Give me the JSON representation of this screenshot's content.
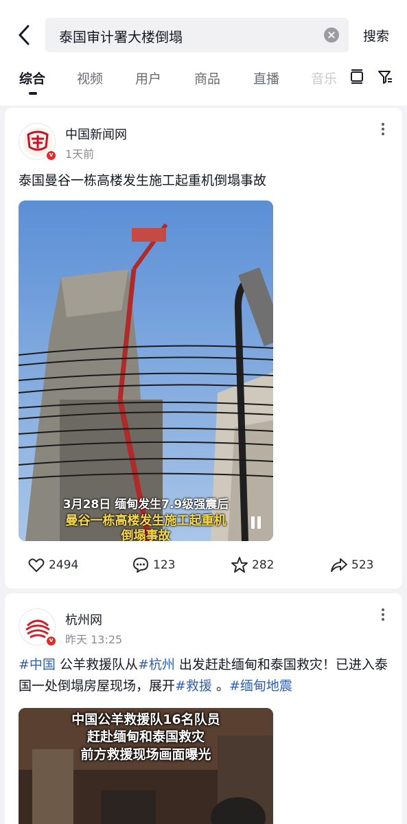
{
  "search": {
    "query": "泰国审计署大楼倒塌",
    "submit_label": "搜索"
  },
  "tabs": [
    {
      "label": "综合",
      "active": true
    },
    {
      "label": "视频"
    },
    {
      "label": "用户"
    },
    {
      "label": "商品"
    },
    {
      "label": "直播"
    },
    {
      "label": "音乐"
    }
  ],
  "posts": [
    {
      "author": "中国新闻网",
      "time": "1天前",
      "text": "泰国曼谷一栋高楼发生施工起重机倒塌事故",
      "video": {
        "caption_line1": "3月28日 缅甸发生7.9级强震后",
        "caption_line2": "曼谷一栋高楼发生施工起重机",
        "caption_line3": "倒塌事故"
      },
      "likes": "2494",
      "comments": "123",
      "favorites": "282",
      "shares": "523"
    },
    {
      "author": "杭州网",
      "time": "昨天 13:25",
      "text_parts": [
        "#中国",
        " 公羊救援队从",
        "#杭州",
        " 出发赶赴缅甸和泰国救灾！已进入泰国一处倒塌房屋现场，展开",
        "#救援",
        " 。",
        "#缅甸地震"
      ],
      "video": {
        "caption_line1": "中国公羊救援队16名队员",
        "caption_line2": "赶赴缅甸和泰国救灾",
        "caption_line3": "前方救援现场画面曝光"
      }
    }
  ],
  "icons": [
    "back-arrow-icon",
    "clear-icon",
    "grid-layout-icon",
    "filter-icon",
    "more-icon",
    "heart-icon",
    "comment-icon",
    "star-icon",
    "share-icon",
    "pause-icon",
    "verified-icon"
  ],
  "colors": {
    "tag": "#2f5fad",
    "badge": "#e02b2b"
  }
}
